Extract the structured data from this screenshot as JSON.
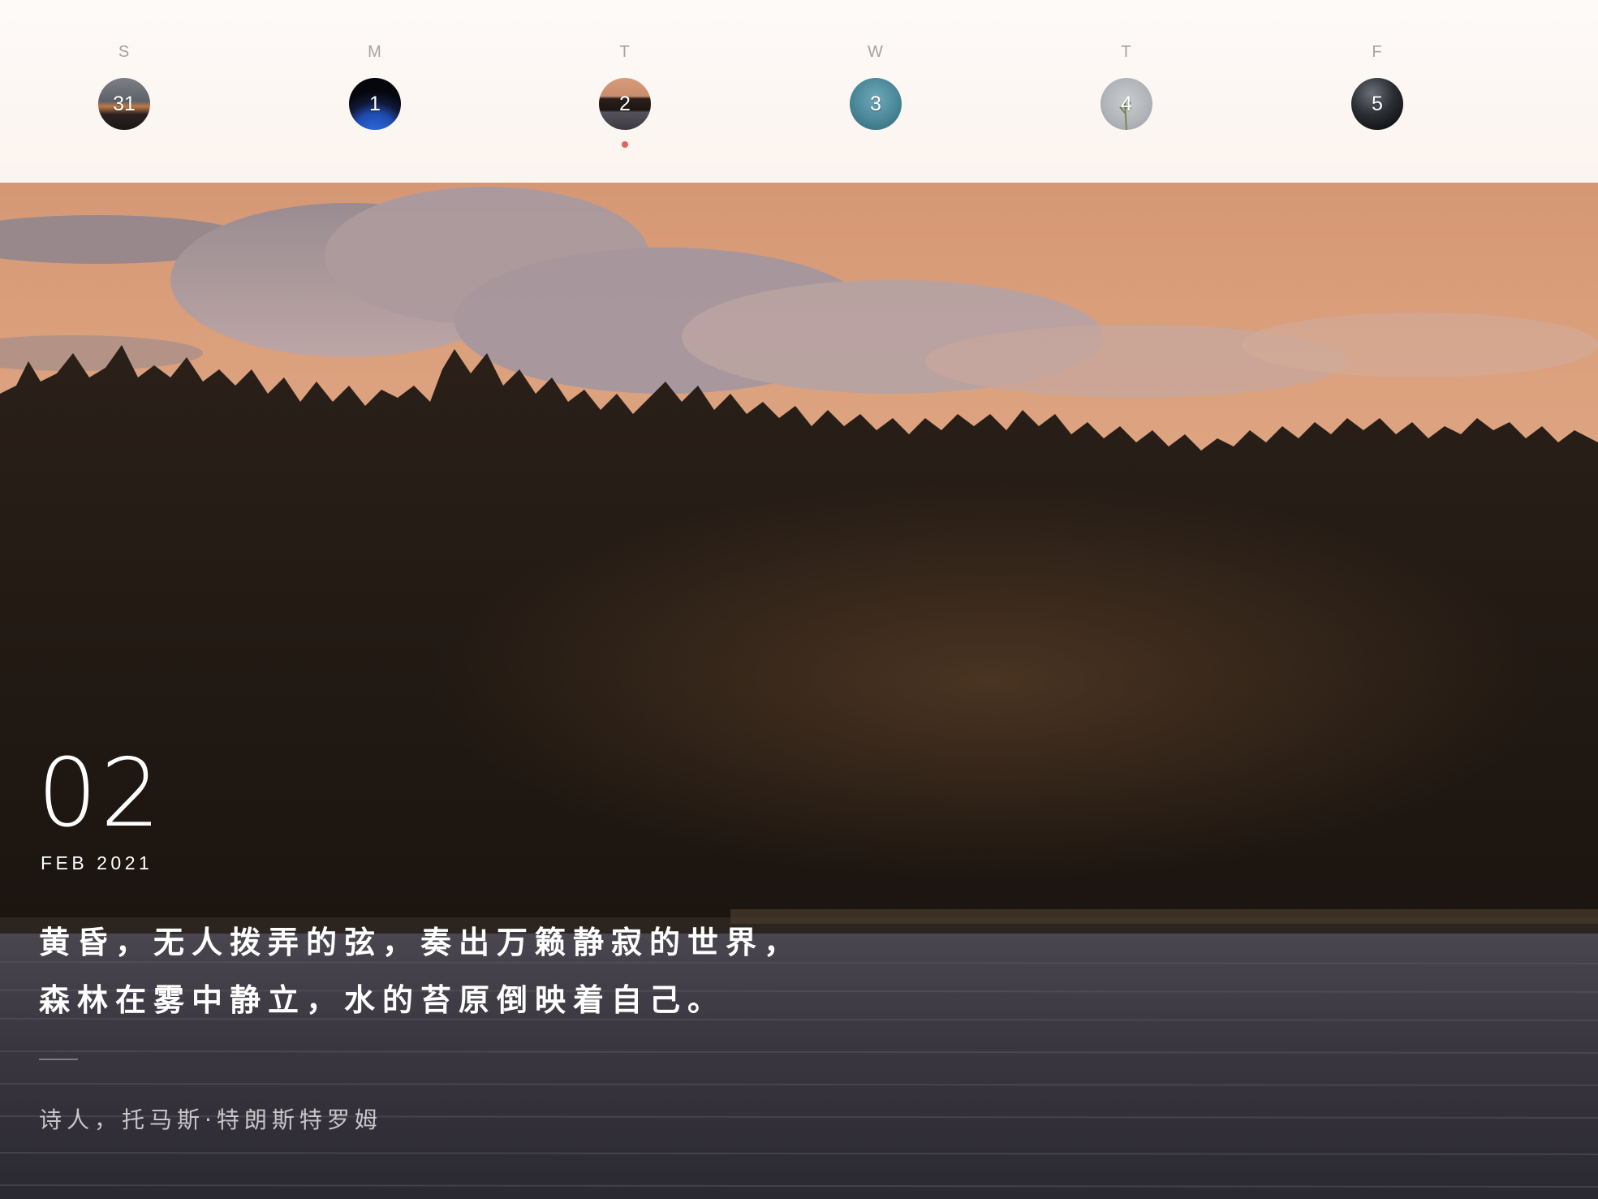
{
  "week": {
    "days": [
      {
        "letter": "S",
        "number": "31",
        "thumb": "sunset-sea-thumb"
      },
      {
        "letter": "M",
        "number": "1",
        "thumb": "earth-night-thumb"
      },
      {
        "letter": "T",
        "number": "2",
        "thumb": "lake-sunset-thumb",
        "selected": true
      },
      {
        "letter": "W",
        "number": "3",
        "thumb": "teal-water-thumb"
      },
      {
        "letter": "T",
        "number": "4",
        "thumb": "grey-plant-thumb"
      },
      {
        "letter": "F",
        "number": "5",
        "thumb": "dark-landscape-thumb"
      }
    ],
    "selected_index": 2
  },
  "entry": {
    "day": "02",
    "month_year": "FEB 2021",
    "quote_line_1": "黄昏，无人拨弄的弦，奏出万籁静寂的世界，",
    "quote_line_2": "森林在雾中静立，水的苔原倒映着自己。",
    "author": "诗人，托马斯·特朗斯特罗姆"
  },
  "colors": {
    "selected_dot": "#e0625a",
    "day_letter": "#a8a29e",
    "strip_background": "#fcf6f2",
    "sky": "#d99c78",
    "forest": "#1e1712",
    "water": "#35323a"
  }
}
